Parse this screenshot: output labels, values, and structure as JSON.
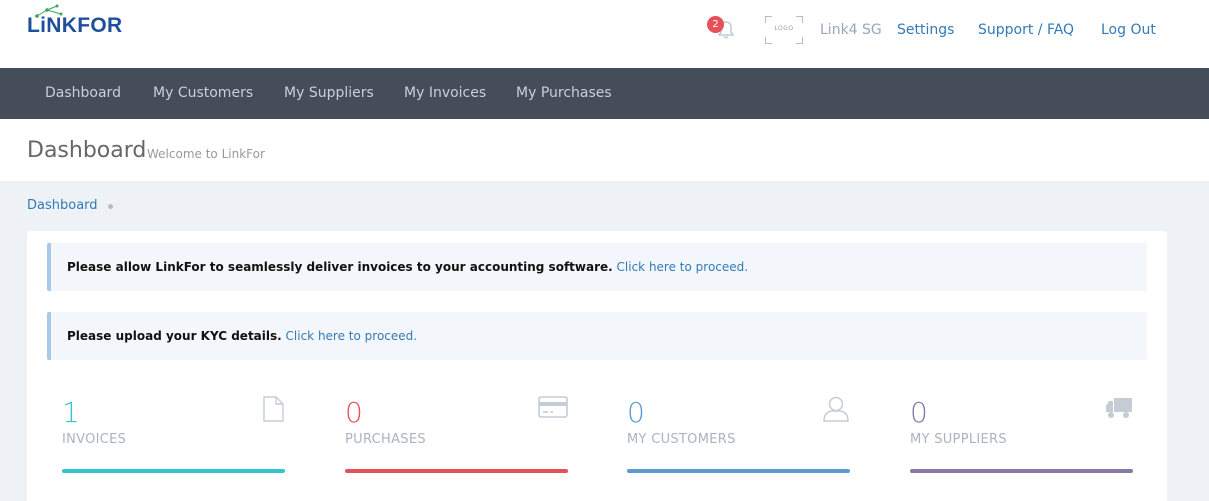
{
  "header": {
    "logo_text": "LiNKFOR",
    "notification_count": "2",
    "company_logo_text": "LOGO",
    "company_name": "Link4 SG",
    "links": {
      "settings": "Settings",
      "support": "Support / FAQ",
      "logout": "Log Out"
    }
  },
  "nav": {
    "items": [
      "Dashboard",
      "My Customers",
      "My Suppliers",
      "My Invoices",
      "My Purchases"
    ]
  },
  "page": {
    "title": "Dashboard",
    "subtitle": "Welcome to LinkFor",
    "breadcrumb": "Dashboard"
  },
  "alerts": [
    {
      "bold": "Please allow LinkFor to seamlessly deliver invoices to your accounting software.",
      "link": "Click here to proceed."
    },
    {
      "bold": "Please upload your KYC details.",
      "link": "Click here to proceed."
    }
  ],
  "stats": [
    {
      "value": "1",
      "label": "INVOICES",
      "icon": "document-icon",
      "color": "#32c5d2"
    },
    {
      "value": "0",
      "label": "PURCHASES",
      "icon": "credit-card-icon",
      "color": "#e7505a"
    },
    {
      "value": "0",
      "label": "MY CUSTOMERS",
      "icon": "user-icon",
      "color": "#5c9bd1"
    },
    {
      "value": "0",
      "label": "MY SUPPLIERS",
      "icon": "truck-icon",
      "color": "#8877a9"
    }
  ],
  "colors": {
    "brand": "#1f4e9c",
    "nav_bg": "#444d58",
    "link": "#337ab7",
    "badge": "#e7505a",
    "bar_invoices": "#32c5d2",
    "bar_purchases": "#e7505a",
    "bar_customers": "#5c9bd1",
    "bar_suppliers": "#8877a9"
  }
}
